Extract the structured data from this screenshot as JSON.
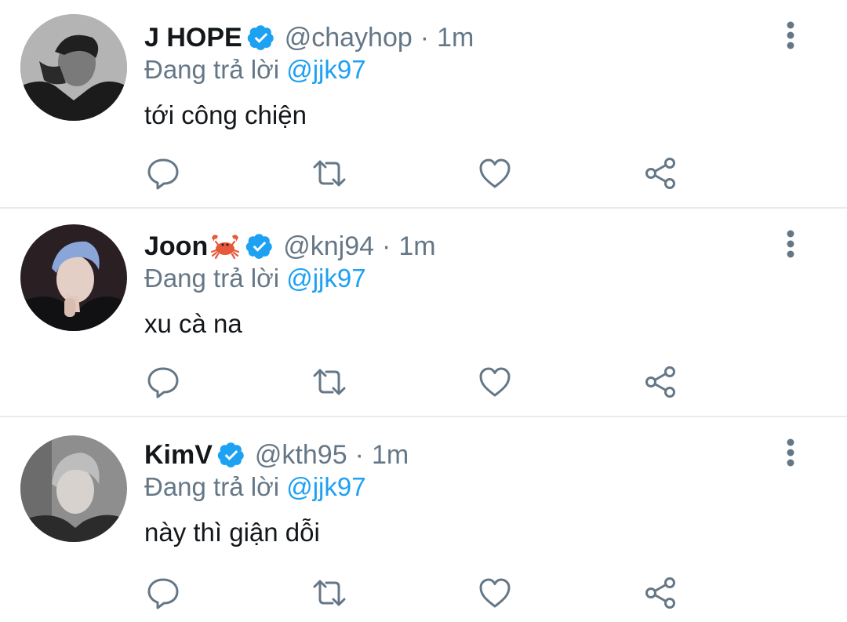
{
  "accent_color": "#1da1f2",
  "muted_color": "#657786",
  "replying_label": "Đang trả lời",
  "tweets": [
    {
      "name": "J HOPE",
      "name_emoji": "",
      "handle": "@chayhop",
      "separator": "·",
      "time": "1m",
      "reply_to": "@jjk97",
      "text": "tới công chiện",
      "verified": true,
      "icons": [
        "more-vertical-icon",
        "reply-icon",
        "retweet-icon",
        "like-icon",
        "share-icon"
      ]
    },
    {
      "name": "Joon",
      "name_emoji": "crab-emoji",
      "handle": "@knj94",
      "separator": "·",
      "time": "1m",
      "reply_to": "@jjk97",
      "text": "xu cà na",
      "verified": true,
      "icons": [
        "more-vertical-icon",
        "reply-icon",
        "retweet-icon",
        "like-icon",
        "share-icon"
      ]
    },
    {
      "name": "KimV",
      "name_emoji": "",
      "handle": "@kth95",
      "separator": "·",
      "time": "1m",
      "reply_to": "@jjk97",
      "text": "này thì giận dỗi",
      "verified": true,
      "icons": [
        "more-vertical-icon",
        "reply-icon",
        "retweet-icon",
        "like-icon",
        "share-icon"
      ]
    }
  ]
}
